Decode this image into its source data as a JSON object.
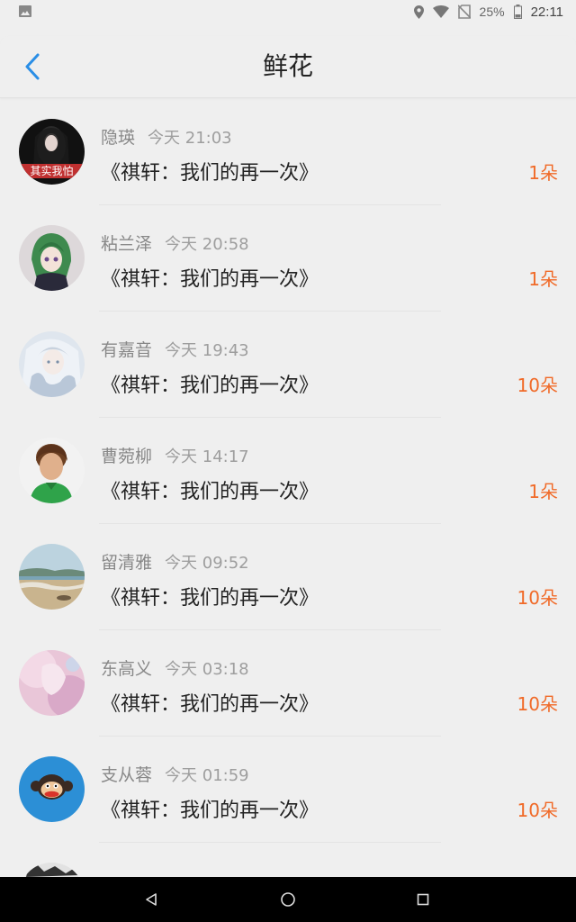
{
  "status_bar": {
    "battery": "25%",
    "time": "22:11",
    "icons": [
      "gallery-icon",
      "location-icon",
      "wifi-icon",
      "no-sim-icon",
      "battery-icon"
    ]
  },
  "header": {
    "title": "鲜花",
    "back_icon": "chevron-left-icon"
  },
  "colors": {
    "accent": "#2a8ee6",
    "count": "#f06a28",
    "background": "#efefef"
  },
  "items": [
    {
      "name": "隐瑛",
      "time": "今天 21:03",
      "message": "《祺轩：我们的再一次》",
      "count": "1朵"
    },
    {
      "name": "粘兰泽",
      "time": "今天 20:58",
      "message": "《祺轩：我们的再一次》",
      "count": "1朵"
    },
    {
      "name": "有嘉音",
      "time": "今天 19:43",
      "message": "《祺轩：我们的再一次》",
      "count": "10朵"
    },
    {
      "name": "曹菀柳",
      "time": "今天 14:17",
      "message": "《祺轩：我们的再一次》",
      "count": "1朵"
    },
    {
      "name": "留清雅",
      "time": "今天 09:52",
      "message": "《祺轩：我们的再一次》",
      "count": "10朵"
    },
    {
      "name": "东高义",
      "time": "今天 03:18",
      "message": "《祺轩：我们的再一次》",
      "count": "10朵"
    },
    {
      "name": "支从蓉",
      "time": "今天 01:59",
      "message": "《祺轩：我们的再一次》",
      "count": "10朵"
    }
  ],
  "avatar_text": {
    "first": "其实我怕"
  },
  "nav": {
    "icons": [
      "back-triangle-icon",
      "home-circle-icon",
      "recents-square-icon"
    ]
  }
}
